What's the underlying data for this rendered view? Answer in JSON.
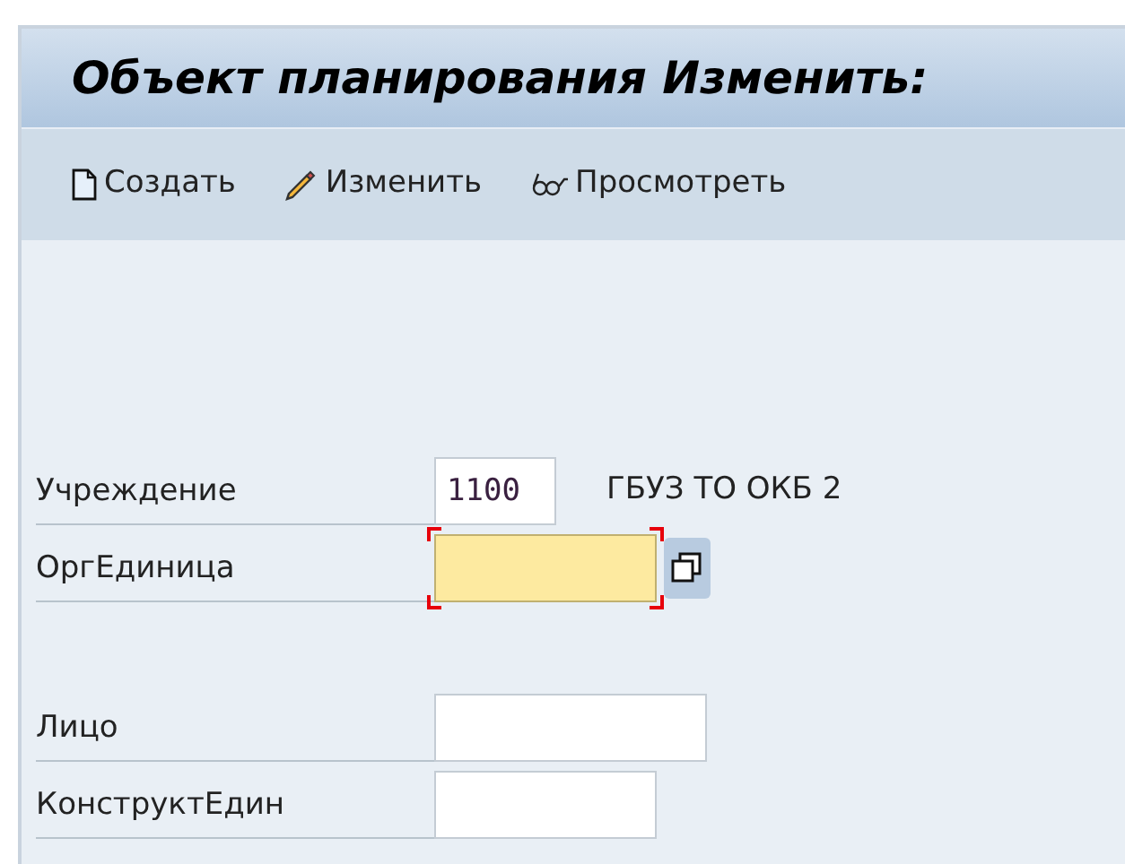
{
  "window": {
    "title": "Объект планирования Изменить:"
  },
  "toolbar": [
    {
      "kind": "create",
      "label": "Создать"
    },
    {
      "kind": "edit",
      "label": "Изменить"
    },
    {
      "kind": "display",
      "label": "Просмотреть"
    }
  ],
  "fields": [
    {
      "label": "Учреждение",
      "value": "1100",
      "focused": false,
      "value_help": false,
      "description": "ГБУЗ ТО ОКБ 2"
    },
    {
      "label": "ОргЕдиница",
      "focused": true,
      "value_help": true
    },
    {
      "label": "Лицо",
      "focused": false,
      "value_help": false
    },
    {
      "label": "КонструктЕдин",
      "focused": false,
      "value_help": false
    }
  ]
}
